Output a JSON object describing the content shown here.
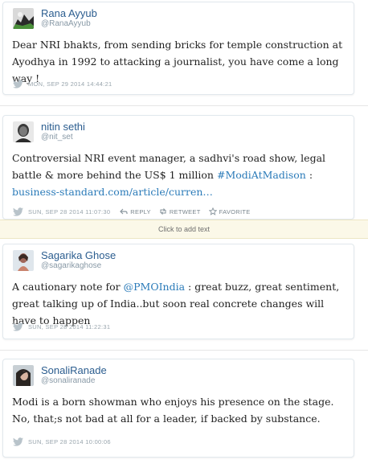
{
  "tweets": [
    {
      "name": "Rana Ayyub",
      "handle": "@RanaAyyub",
      "text_parts": [
        "Dear NRI bhakts, from sending bricks for temple construction at Ayodhya in 1992 to attacking a journalist, you have come a long way !"
      ],
      "timestamp": "MON, SEP 29 2014 14:44:21",
      "avatar_icon": "profile-photo"
    },
    {
      "name": "nitin sethi",
      "handle": "@nit_set",
      "text_parts": [
        "Controversial NRI event manager, a sadhvi's road show, legal battle & more behind the US$ 1 million ",
        "#ModiAtMadison",
        " : ",
        "business-standard.com/article/curren…"
      ],
      "timestamp": "SUN, SEP 28 2014 11:07:30",
      "avatar_icon": "profile-photo",
      "actions": {
        "reply": "REPLY",
        "retweet": "RETWEET",
        "favorite": "FAVORITE"
      }
    },
    {
      "name": "Sagarika Ghose",
      "handle": "@sagarikaghose",
      "text_parts": [
        "A cautionary note for ",
        "@PMOIndia",
        " : great buzz, great sentiment, great talking up of India..but soon real concrete changes will have to happen"
      ],
      "timestamp": "SUN, SEP 28 2014 11:22:31",
      "avatar_icon": "profile-photo"
    },
    {
      "name": "SonaliRanade",
      "handle": "@sonaliranade",
      "text_parts": [
        "Modi is a born showman who enjoys his presence on the stage. No, that;s not bad at all for a leader, if backed by substance."
      ],
      "timestamp": "SUN, SEP 28 2014 10:00:06",
      "avatar_icon": "profile-photo"
    }
  ],
  "click_to_add": "Click to add text",
  "colors": {
    "name": "#2b5d8f",
    "link": "#2b7bb9",
    "meta": "#99a5ad",
    "banner": "#fbf8e8"
  },
  "icons": {
    "bird": "twitter-bird-icon",
    "reply": "reply-arrow-icon",
    "retweet": "retweet-icon",
    "favorite": "star-icon"
  }
}
